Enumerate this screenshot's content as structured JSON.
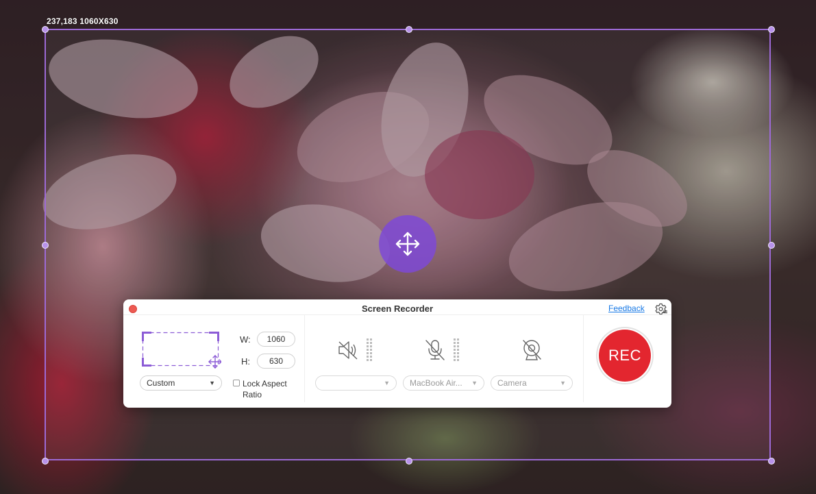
{
  "selection": {
    "coords_label": "237,183 1060X630"
  },
  "panel": {
    "title": "Screen Recorder",
    "feedback_label": "Feedback",
    "region": {
      "mode": "Custom",
      "width_label": "W:",
      "width_value": "1060",
      "height_label": "H:",
      "height_value": "630",
      "lock_aspect_label": "Lock Aspect Ratio",
      "lock_aspect_checked": false
    },
    "audio": {
      "system_sound_icon": "speaker-muted-icon",
      "system_sound_value": "",
      "microphone_icon": "microphone-muted-icon",
      "microphone_value": "MacBook Air...",
      "camera_icon": "camera-off-icon",
      "camera_value": "Camera"
    },
    "rec_label": "REC"
  },
  "colors": {
    "selection": "#9d6ad6",
    "move_button": "#7e49d6",
    "rec": "#e3262f",
    "link": "#1678e5"
  }
}
